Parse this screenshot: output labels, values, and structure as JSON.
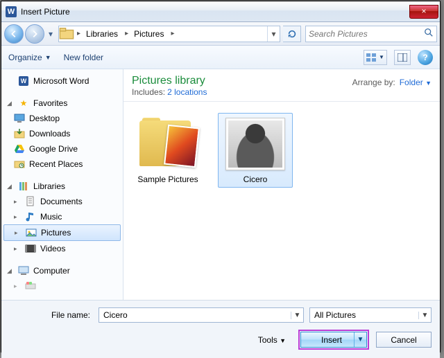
{
  "window": {
    "title": "Insert Picture",
    "close": "×"
  },
  "nav": {
    "breadcrumb": [
      "Libraries",
      "Pictures"
    ],
    "refresh": "↻"
  },
  "search": {
    "placeholder": "Search Pictures"
  },
  "toolbar": {
    "organize": "Organize",
    "newfolder": "New folder"
  },
  "sidebar": {
    "word": "Microsoft Word",
    "favorites": "Favorites",
    "fav_items": [
      "Desktop",
      "Downloads",
      "Google Drive",
      "Recent Places"
    ],
    "libraries": "Libraries",
    "lib_items": [
      "Documents",
      "Music",
      "Pictures",
      "Videos"
    ],
    "computer": "Computer"
  },
  "library": {
    "title": "Pictures library",
    "includes_label": "Includes:",
    "includes_link": "2 locations",
    "arrange_label": "Arrange by:",
    "arrange_value": "Folder"
  },
  "items": [
    {
      "label": "Sample Pictures",
      "kind": "folder"
    },
    {
      "label": "Cicero",
      "kind": "image"
    }
  ],
  "bottom": {
    "filename_label": "File name:",
    "filename_value": "Cicero",
    "filter": "All Pictures",
    "tools": "Tools",
    "insert": "Insert",
    "cancel": "Cancel"
  }
}
